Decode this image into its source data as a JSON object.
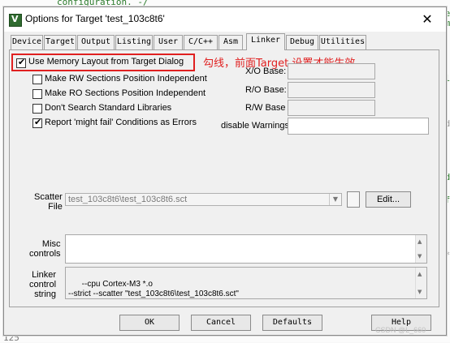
{
  "background_code": [
    "configuration. -/",
    "le",
    "om",
    "bl",
    "dd",
    "a",
    "dd",
    "a",
    "ff",
    "a",
    "**",
    "a"
  ],
  "background_line_number": "125",
  "dialog": {
    "title": "Options for Target 'test_103c8t6'",
    "close_glyph": "✕",
    "tabs": [
      "Device",
      "Target",
      "Output",
      "Listing",
      "User",
      "C/C++",
      "Asm",
      "Linker",
      "Debug",
      "Utilities"
    ],
    "active_tab": "Linker"
  },
  "linker": {
    "use_memory_layout": {
      "label": "Use Memory Layout from Target Dialog",
      "checked": true
    },
    "make_rw": {
      "label": "Make RW Sections Position Independent",
      "checked": false
    },
    "make_ro": {
      "label": "Make RO Sections Position Independent",
      "checked": false
    },
    "dont_search": {
      "label": "Don't Search Standard Libraries",
      "checked": false
    },
    "report_might_fail": {
      "label": "Report 'might fail' Conditions as Errors",
      "checked": true
    },
    "xo_base_label": "X/O Base:",
    "ro_base_label": "R/O Base:",
    "rw_base_label": "R/W Base",
    "disable_warnings_label": "disable Warnings:",
    "scatter_file_label": "Scatter\nFile",
    "scatter_file_value": "test_103c8t6\\test_103c8t6.sct",
    "edit_button": "Edit...",
    "misc_controls_label": "Misc\ncontrols",
    "linker_control_label": "Linker\ncontrol\nstring",
    "linker_control_string": "--cpu Cortex-M3 *.o\n--strict --scatter \"test_103c8t6\\test_103c8t6.sct\""
  },
  "annotation": "勾线，前面Target 设置才能生效",
  "buttons": {
    "ok": "OK",
    "cancel": "Cancel",
    "defaults": "Defaults",
    "help": "Help"
  },
  "watermark": "CSDN @L_660"
}
